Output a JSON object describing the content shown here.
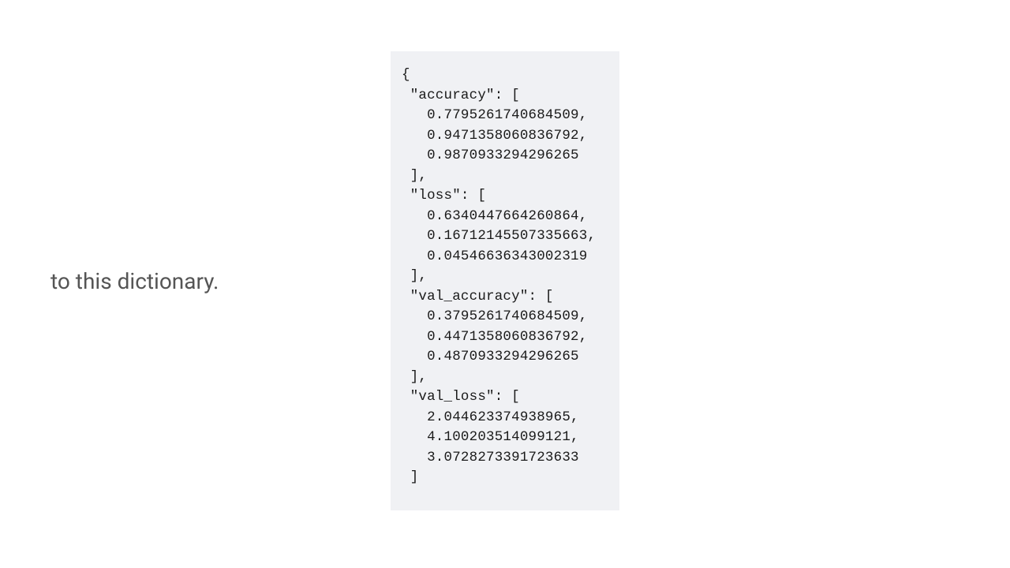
{
  "caption": "to this dictionary.",
  "code": {
    "open_brace": "{",
    "key1": " \"accuracy\": [",
    "acc0": "   0.7795261740684509,",
    "acc1": "   0.9471358060836792,",
    "acc2": "   0.9870933294296265",
    "close1": " ],",
    "key2": " \"loss\": [",
    "loss0": "   0.6340447664260864,",
    "loss1": "   0.16712145507335663,",
    "loss2": "   0.04546636343002319",
    "close2": " ],",
    "key3": " \"val_accuracy\": [",
    "vacc0": "   0.3795261740684509,",
    "vacc1": "   0.4471358060836792,",
    "vacc2": "   0.4870933294296265",
    "close3": " ],",
    "key4": " \"val_loss\": [",
    "vloss0": "   2.044623374938965,",
    "vloss1": "   4.100203514099121,",
    "vloss2": "   3.0728273391723633",
    "close4": " ]"
  }
}
